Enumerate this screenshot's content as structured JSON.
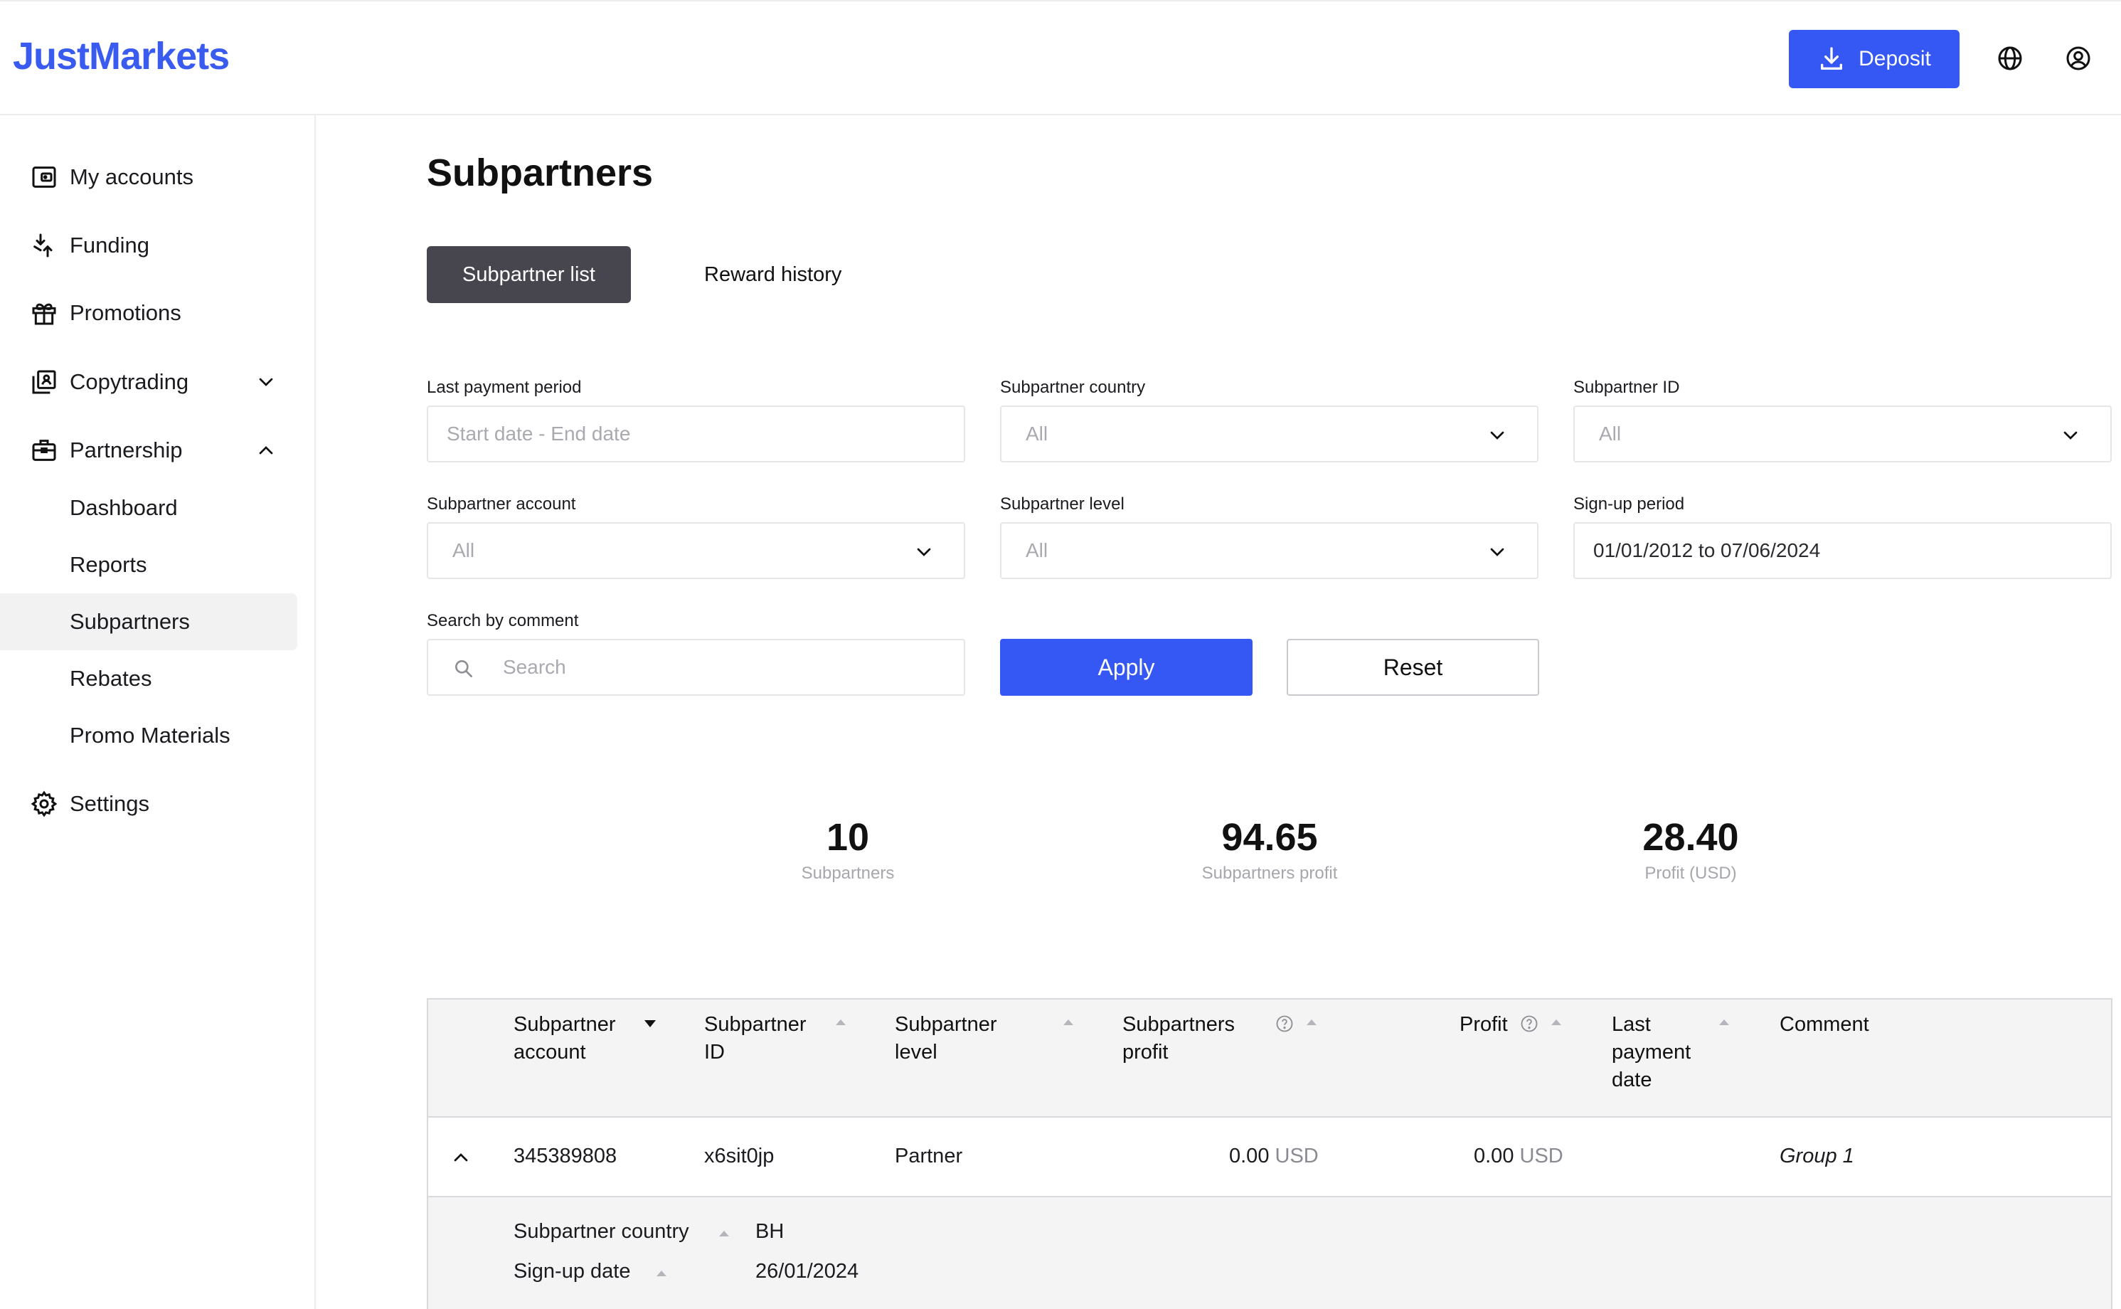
{
  "header": {
    "logo": "JustMarkets",
    "deposit_label": "Deposit",
    "colors": {
      "accent": "#3558f5",
      "logo": "#3a5bf0"
    }
  },
  "sidebar": {
    "items": [
      {
        "label": "My accounts",
        "icon": "wallet-icon"
      },
      {
        "label": "Funding",
        "icon": "funding-icon"
      },
      {
        "label": "Promotions",
        "icon": "gift-icon"
      },
      {
        "label": "Copytrading",
        "icon": "copytrading-icon"
      },
      {
        "label": "Partnership",
        "icon": "briefcase-icon"
      },
      {
        "label": "Settings",
        "icon": "gear-icon"
      }
    ],
    "partnership_sub": [
      {
        "label": "Dashboard"
      },
      {
        "label": "Reports"
      },
      {
        "label": "Subpartners",
        "active": true
      },
      {
        "label": "Rebates"
      },
      {
        "label": "Promo Materials"
      }
    ]
  },
  "main": {
    "title": "Subpartners",
    "tabs": [
      "Subpartner list",
      "Reward history"
    ],
    "filters": {
      "last_payment_period": {
        "label": "Last payment period",
        "placeholder": "Start date - End date"
      },
      "subpartner_country": {
        "label": "Subpartner country",
        "value": "All"
      },
      "subpartner_id": {
        "label": "Subpartner ID",
        "value": "All"
      },
      "subpartner_account": {
        "label": "Subpartner account",
        "value": "All"
      },
      "subpartner_level": {
        "label": "Subpartner level",
        "value": "All"
      },
      "signup_period": {
        "label": "Sign-up period",
        "value": "01/01/2012 to 07/06/2024"
      },
      "search_comment": {
        "label": "Search by comment",
        "placeholder": "Search"
      }
    },
    "apply_label": "Apply",
    "reset_label": "Reset",
    "stats": [
      {
        "value": "10",
        "label": "Subpartners"
      },
      {
        "value": "94.65",
        "label": "Subpartners profit"
      },
      {
        "value": "28.40",
        "label": "Profit (USD)"
      }
    ],
    "table": {
      "columns": [
        {
          "line1": "Subpartner",
          "line2": "account"
        },
        {
          "line1": "Subpartner",
          "line2": "ID"
        },
        {
          "line1": "Subpartner",
          "line2": "level"
        },
        {
          "line1": "Subpartners",
          "line2": "profit"
        },
        {
          "line1": "Profit",
          "line2": ""
        },
        {
          "line1": "Last",
          "line2": "payment",
          "line3": "date"
        },
        {
          "line1": "Comment",
          "line2": ""
        }
      ],
      "rows": [
        {
          "account": "345389808",
          "id": "x6sit0jp",
          "level": "Partner",
          "subpartners_profit": "0.00",
          "profit": "0.00",
          "unit": "USD",
          "comment": "Group 1",
          "details": {
            "country_label": "Subpartner country",
            "country": "BH",
            "signup_label": "Sign-up date",
            "signup": "26/01/2024"
          }
        }
      ]
    }
  }
}
